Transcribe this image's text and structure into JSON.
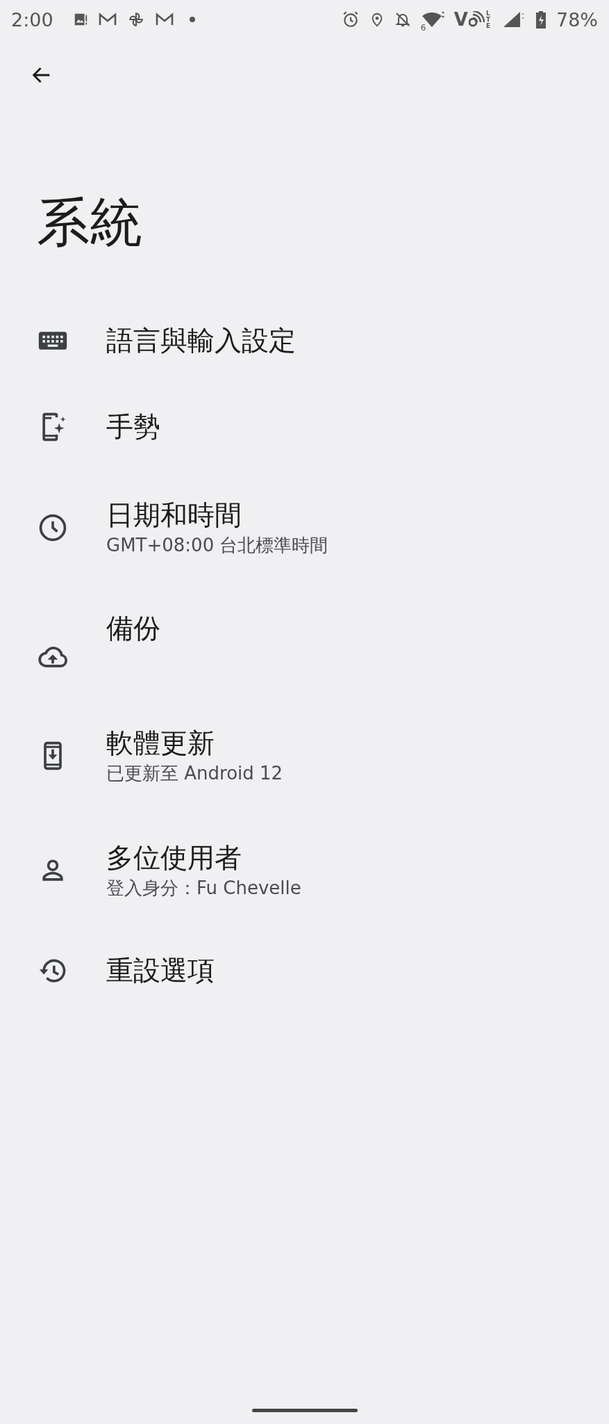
{
  "status_bar": {
    "time": "2:00",
    "wifi_badge": "6",
    "volte_letter": "V",
    "lte_label": "LTE",
    "battery": "78%"
  },
  "title": "系統",
  "items": [
    {
      "kind": "single",
      "title": "語言與輸入設定"
    },
    {
      "kind": "single",
      "title": "手勢"
    },
    {
      "kind": "summary",
      "title": "日期和時間",
      "summary": "GMT+08:00 台北標準時間"
    },
    {
      "kind": "tall",
      "title": "備份"
    },
    {
      "kind": "summary",
      "title": "軟體更新",
      "summary": "已更新至 Android 12"
    },
    {
      "kind": "summary",
      "title": "多位使用者",
      "summary": "登入身分：Fu Chevelle"
    },
    {
      "kind": "single",
      "title": "重設選項"
    }
  ]
}
